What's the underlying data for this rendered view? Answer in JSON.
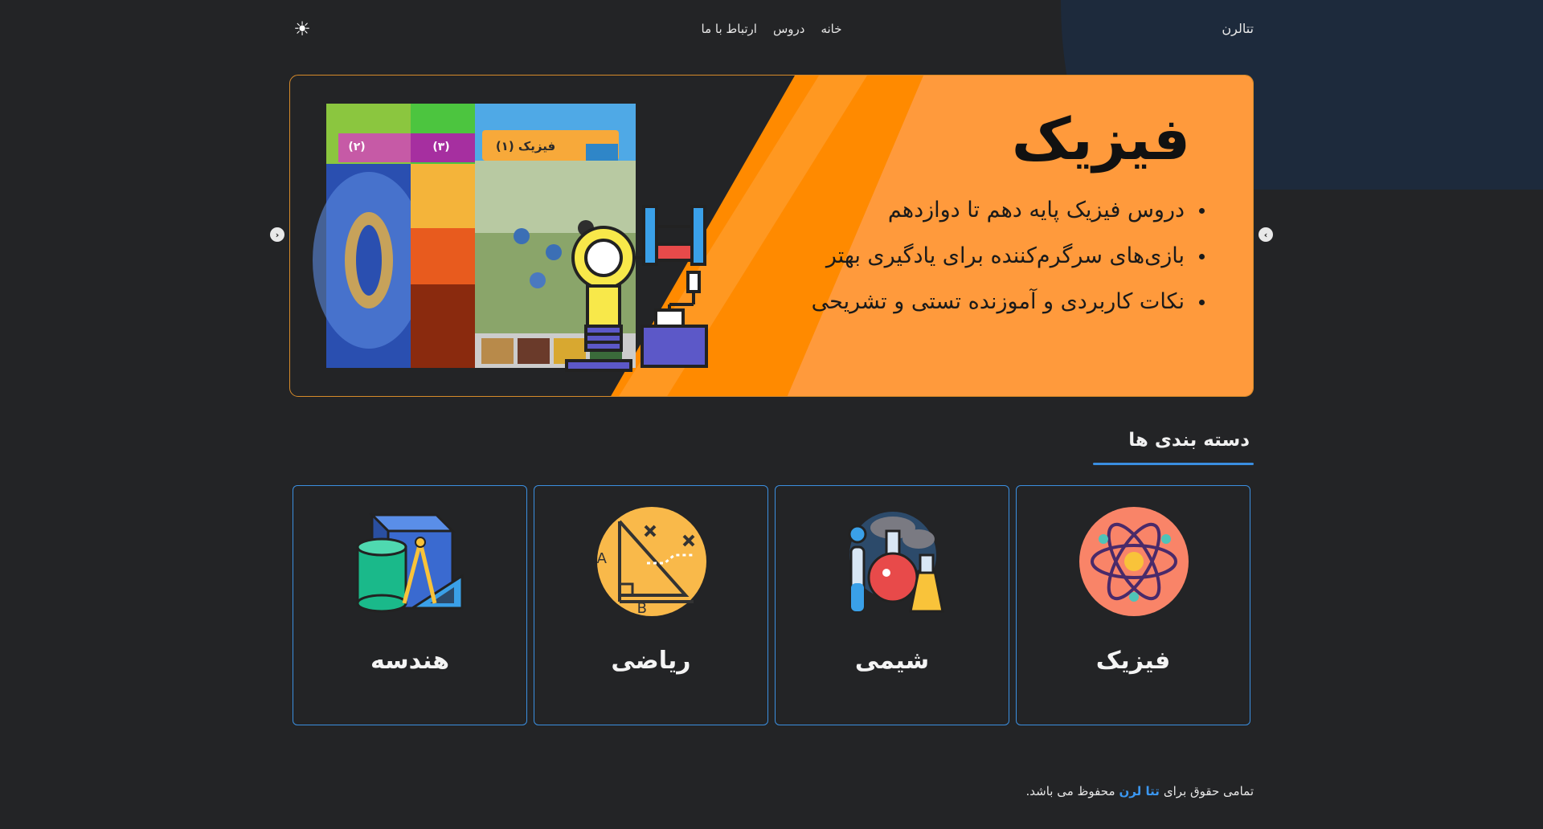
{
  "header": {
    "brand": "تتالرن",
    "nav": [
      "خانه",
      "دروس",
      "ارتباط با ما"
    ],
    "theme_icon": "sun-icon"
  },
  "hero": {
    "title": "فیزیک",
    "bullets": [
      "دروس فیزیک پایه دهم تا دوازدهم",
      "بازی‌های سرگرم‌کننده برای یادگیری بهتر",
      "نکات کاربردی و آموزنده تستی و تشریحی"
    ],
    "books": [
      {
        "label": "فیزیک (۱)",
        "color": "#f7a93a"
      },
      {
        "label": "(۳)",
        "color": "#a62fa0"
      },
      {
        "label": "(۲)",
        "color": "#c65aa6"
      }
    ],
    "orange": "#ff9a3c",
    "orange_dark": "#ff8a00"
  },
  "categories": {
    "title": "دسته بندی ها",
    "items": [
      {
        "label": "فیزیک",
        "icon": "atom-icon"
      },
      {
        "label": "شیمی",
        "icon": "chemistry-flask-icon"
      },
      {
        "label": "ریاضی",
        "icon": "math-graph-icon"
      },
      {
        "label": "هندسه",
        "icon": "geometry-shapes-icon"
      }
    ]
  },
  "footer": {
    "prefix": "تمامی حقوق برای",
    "brand": "تتا لرن",
    "suffix": "محفوظ می باشد."
  },
  "colors": {
    "background": "#232426",
    "accent": "#3b8fe0",
    "hero_border": "#d68a2a"
  }
}
